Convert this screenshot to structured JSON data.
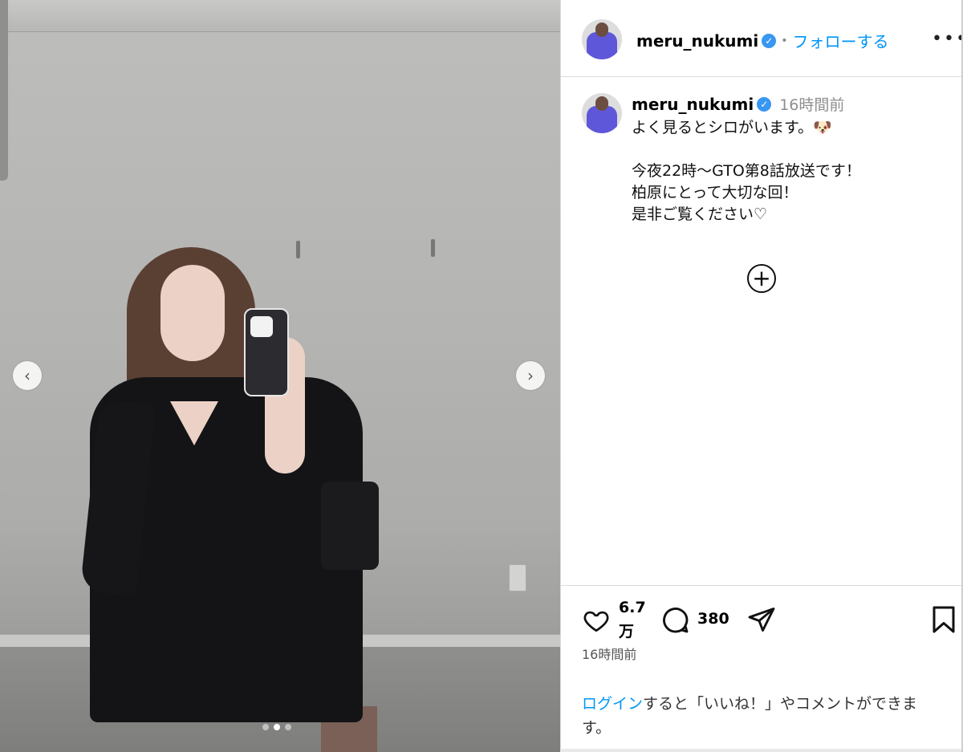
{
  "post": {
    "username": "meru_nukumi",
    "follow_label": "フォローする",
    "separator": "•",
    "more_label": "•••",
    "time_ago": "16時間前",
    "caption": "よく見るとシロがいます。🐶\n\n今夜22時〜GTO第8話放送です！\n柏原にとって大切な回！\n是非ご覧ください♡",
    "plus_label": "+"
  },
  "carousel": {
    "prev_label": "‹",
    "next_label": "›",
    "slide_count": 3,
    "active_slide": 2
  },
  "actions": {
    "likes_line1": "6.7",
    "likes_line2": "万",
    "comments": "380",
    "timestamp": "16時間前"
  },
  "login_prompt": {
    "link": "ログイン",
    "text": "すると「いいね！」やコメントができます。"
  },
  "colors": {
    "accent": "#0095f6",
    "verified": "#3897f0"
  }
}
